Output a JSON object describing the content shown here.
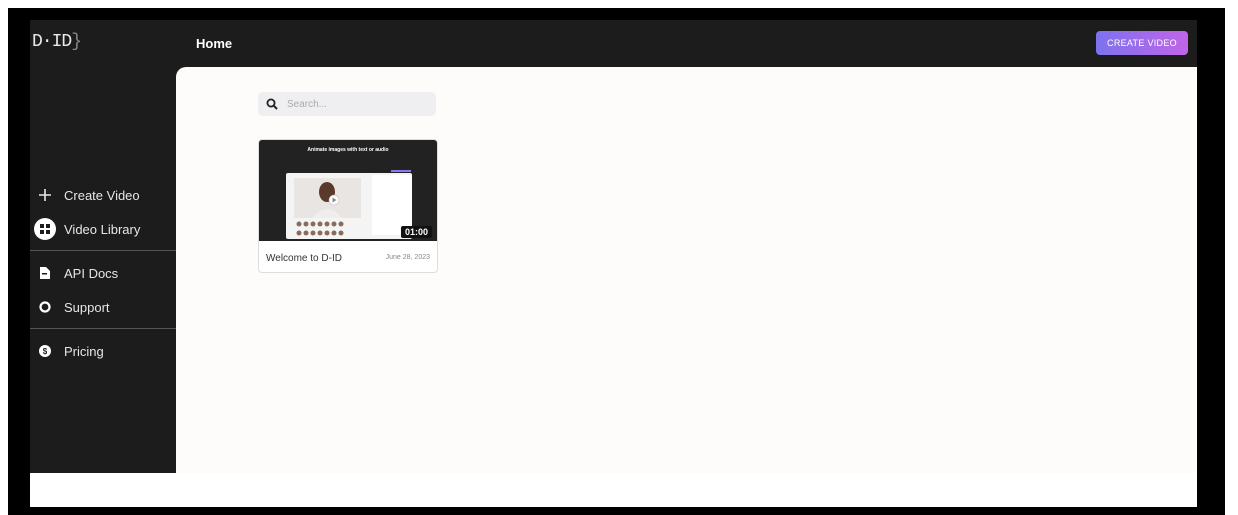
{
  "header": {
    "logo": "D·ID",
    "title": "Home",
    "create_button": "CREATE VIDEO"
  },
  "sidebar": {
    "items": [
      {
        "label": "Create Video",
        "icon": "plus-icon"
      },
      {
        "label": "Video Library",
        "icon": "grid-icon"
      },
      {
        "label": "API Docs",
        "icon": "document-icon"
      },
      {
        "label": "Support",
        "icon": "lifebuoy-icon"
      },
      {
        "label": "Pricing",
        "icon": "dollar-icon"
      }
    ]
  },
  "search": {
    "placeholder": "Search..."
  },
  "videos": [
    {
      "title": "Welcome to D-ID",
      "date": "June 28, 2023",
      "duration": "01:00",
      "thumbnail_heading": "Animate images with text or audio"
    }
  ],
  "colors": {
    "sidebar_bg": "#1c1c1c",
    "main_bg": "#fdfcfb",
    "accent_gradient_start": "#7d72ee",
    "accent_gradient_end": "#c065e8"
  }
}
